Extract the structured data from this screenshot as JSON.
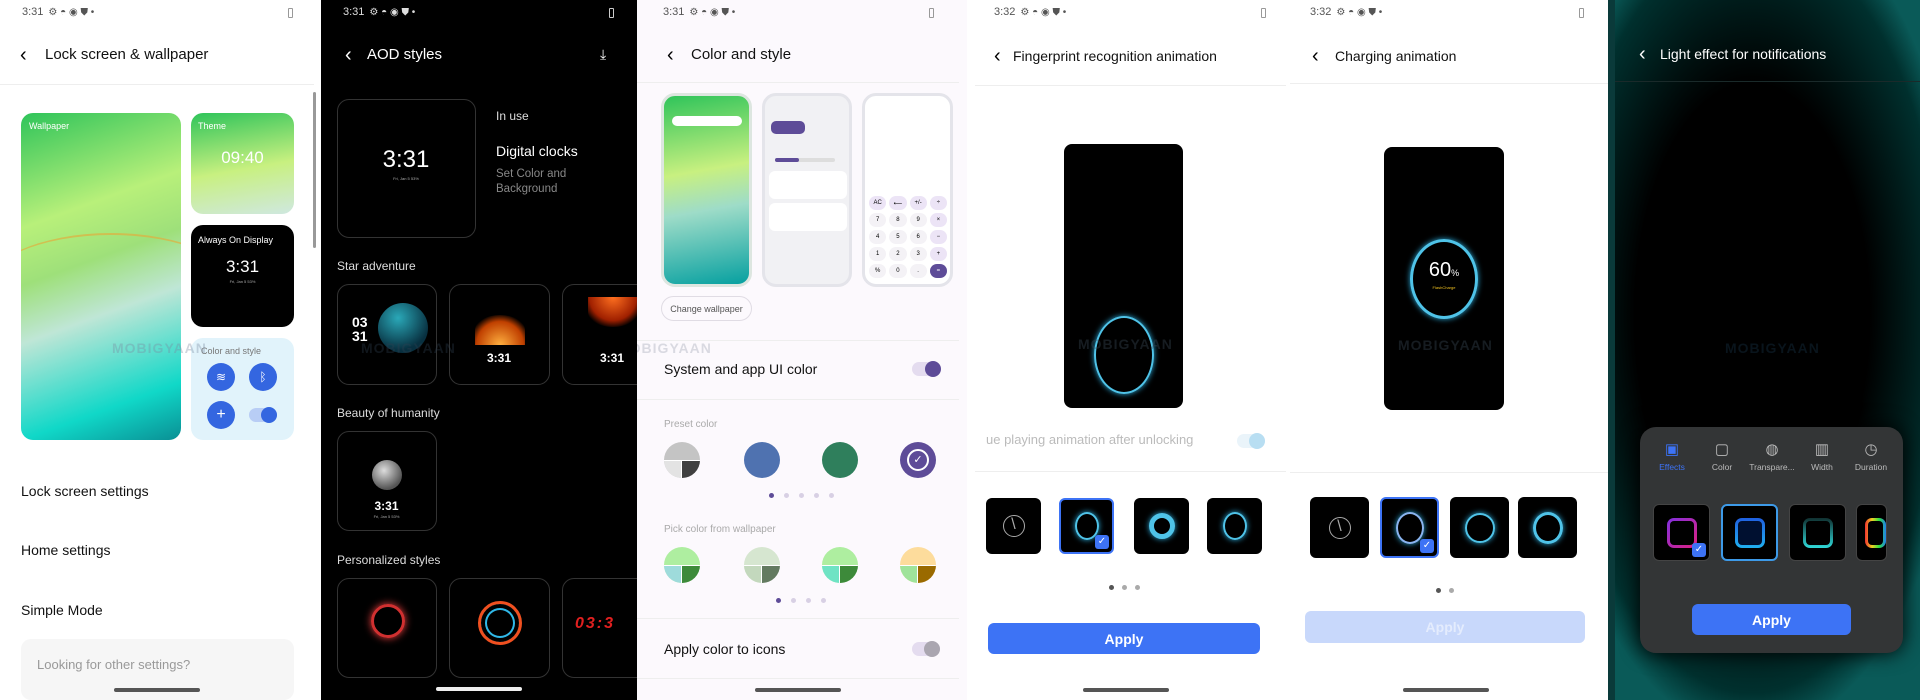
{
  "watermark": "MOBIGYAAN",
  "status_icons": [
    "gear-icon",
    "circle-icon",
    "eye-icon",
    "shield-icon",
    "dot-icon",
    "battery-icon"
  ],
  "p1": {
    "time": "3:31",
    "title": "Lock screen & wallpaper",
    "wallpaper": "Wallpaper",
    "theme": "Theme",
    "theme_time": "09:40",
    "aod": "Always On Display",
    "aod_time": "3:31",
    "aod_date": "Fri, Jan 5 53%",
    "color_style": "Color and style",
    "items": [
      "Lock screen settings",
      "Home settings",
      "Simple Mode"
    ],
    "search_hint": "Looking for other settings?"
  },
  "p2": {
    "time": "3:31",
    "title": "AOD styles",
    "current_time": "3:31",
    "current_date": "Fri, Jan 5 53%",
    "in_use": "In use",
    "style_name": "Digital clocks",
    "style_sub": "Set Color and Background",
    "sections": [
      {
        "label": "Star adventure",
        "cards": [
          "03\n31",
          "3:31",
          "3:31"
        ]
      },
      {
        "label": "Beauty of humanity",
        "cards": [
          "3:31"
        ]
      },
      {
        "label": "Personalized styles",
        "cards": [
          "",
          "",
          "03:3"
        ]
      }
    ],
    "card_date": "Fri, Jan 5 53%"
  },
  "p3": {
    "time": "3:31",
    "title": "Color and style",
    "change_wallpaper": "Change wallpaper",
    "system_color": "System and app UI color",
    "system_color_on": true,
    "preset_label": "Preset color",
    "preset_colors": [
      [
        "#c4c4c4",
        "#e3e3e3",
        "#404040"
      ],
      [
        "#4f72b0"
      ],
      [
        "#2f7f5c"
      ],
      [
        "#5e4c98"
      ]
    ],
    "preset_selected": 3,
    "wallpaper_label": "Pick color from wallpaper",
    "wallpaper_colors": [
      [
        "#aeeea0",
        "#9edbdb",
        "#3d8a3a"
      ],
      [
        "#d6e6d0",
        "#c3d8bd",
        "#637a60"
      ],
      [
        "#aeeea0",
        "#6fe3c4",
        "#3d8a3a"
      ],
      [
        "#fddc9c",
        "#9fe39a",
        "#9a6a00"
      ]
    ],
    "apply_icons": "Apply color to icons",
    "apply_icons_on": false,
    "calc_keys": [
      "AC",
      "⟵",
      "+/-",
      "÷",
      "7",
      "8",
      "9",
      "×",
      "4",
      "5",
      "6",
      "−",
      "1",
      "2",
      "3",
      "+",
      "%",
      "0",
      ".",
      "="
    ],
    "accent": "#5e4c98"
  },
  "p4": {
    "time": "3:32",
    "title": "Fingerprint recognition animation",
    "continue_label": "ue playing animation after unlocking",
    "continue_on": true,
    "selected": 1,
    "page": 1,
    "pages": 3,
    "apply": "Apply",
    "accent": "#3d73f5"
  },
  "p5": {
    "time": "3:32",
    "title": "Charging animation",
    "percent": "60",
    "percent_sign": "%",
    "brand": "FlashCharge",
    "selected": 1,
    "page": 1,
    "pages": 2,
    "apply": "Apply",
    "apply_enabled": false
  },
  "p6": {
    "title": "Light effect for notifications",
    "tabs": [
      {
        "label": "Effects",
        "icon": "effects-icon",
        "active": true
      },
      {
        "label": "Color",
        "icon": "color-icon"
      },
      {
        "label": "Transpare...",
        "icon": "transparency-icon"
      },
      {
        "label": "Width",
        "icon": "width-icon"
      },
      {
        "label": "Duration",
        "icon": "clock-icon"
      }
    ],
    "selected": 0,
    "apply": "Apply"
  }
}
